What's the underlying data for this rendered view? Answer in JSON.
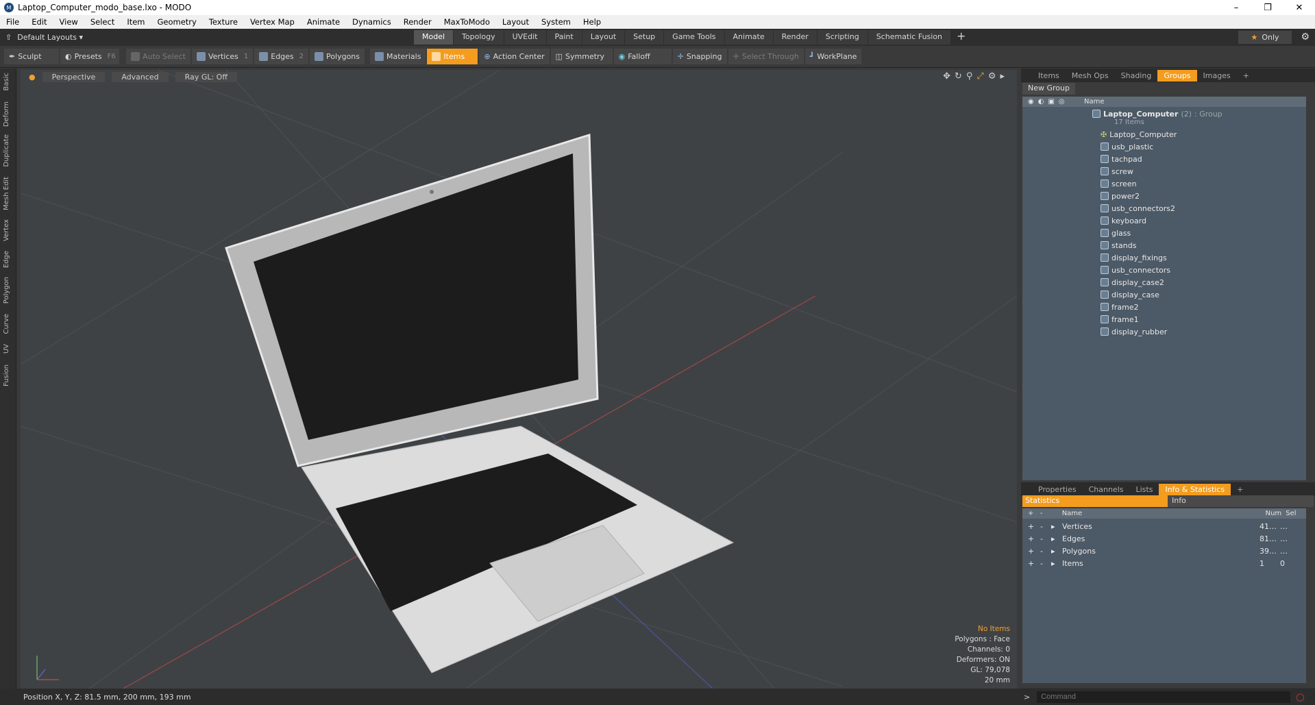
{
  "window": {
    "title": "Laptop_Computer_modo_base.lxo - MODO",
    "app_icon": "modo-logo-icon"
  },
  "menu": [
    "File",
    "Edit",
    "View",
    "Select",
    "Item",
    "Geometry",
    "Texture",
    "Vertex Map",
    "Animate",
    "Dynamics",
    "Render",
    "MaxToModo",
    "Layout",
    "System",
    "Help"
  ],
  "layouts": {
    "label": "Default Layouts",
    "tabs": [
      "Model",
      "Topology",
      "UVEdit",
      "Paint",
      "Layout",
      "Setup",
      "Game Tools",
      "Animate",
      "Render",
      "Scripting",
      "Schematic Fusion"
    ],
    "active": "Model",
    "only_label": "Only"
  },
  "toolbar": {
    "sculpt": "Sculpt",
    "presets": "Presets",
    "presets_key": "F6",
    "auto_select": "Auto Select",
    "vertices": "Vertices",
    "vertices_n": "1",
    "edges": "Edges",
    "edges_n": "2",
    "polygons": "Polygons",
    "materials": "Materials",
    "items": "Items",
    "action_center": "Action Center",
    "symmetry": "Symmetry",
    "falloff": "Falloff",
    "snapping": "Snapping",
    "select_through": "Select Through",
    "workplane": "WorkPlane"
  },
  "left_tabs": [
    "Basic",
    "Deform",
    "Duplicate",
    "Mesh Edit",
    "Vertex",
    "Edge",
    "Polygon",
    "Curve",
    "UV",
    "Fusion"
  ],
  "viewport": {
    "view": "Perspective",
    "shading": "Advanced",
    "raygl": "Ray GL: Off",
    "info": {
      "no_items": "No Items",
      "polygons": "Polygons : Face",
      "channels": "Channels: 0",
      "deformers": "Deformers: ON",
      "gl": "GL: 79,078",
      "scale": "20 mm"
    }
  },
  "status": {
    "position": "Position X, Y, Z:   81.5 mm, 200 mm, 193 mm"
  },
  "right_top": {
    "tabs": [
      "Items",
      "Mesh Ops",
      "Shading",
      "Groups",
      "Images"
    ],
    "active": "Groups",
    "new_group": "New Group",
    "name_col": "Name",
    "group": {
      "name": "Laptop_Computer",
      "count": "(2)",
      "type": ": Group",
      "items": "17 Items"
    },
    "children": [
      "Laptop_Computer",
      "usb_plastic",
      "tachpad",
      "screw",
      "screen",
      "power2",
      "usb_connectors2",
      "keyboard",
      "glass",
      "stands",
      "display_fixings",
      "usb_connectors",
      "display_case2",
      "display_case",
      "frame2",
      "frame1",
      "display_rubber"
    ]
  },
  "right_bottom": {
    "tabs": [
      "Properties",
      "Channels",
      "Lists",
      "Info & Statistics"
    ],
    "active": "Info & Statistics",
    "statistics": "Statistics",
    "info": "Info",
    "columns": {
      "name": "Name",
      "num": "Num",
      "sel": "Sel"
    },
    "rows": [
      {
        "name": "Vertices",
        "num": "41…",
        "sel": "…"
      },
      {
        "name": "Edges",
        "num": "81…",
        "sel": "…"
      },
      {
        "name": "Polygons",
        "num": "39…",
        "sel": "…"
      },
      {
        "name": "Items",
        "num": "1",
        "sel": "0"
      }
    ]
  },
  "command": {
    "placeholder": "Command"
  }
}
